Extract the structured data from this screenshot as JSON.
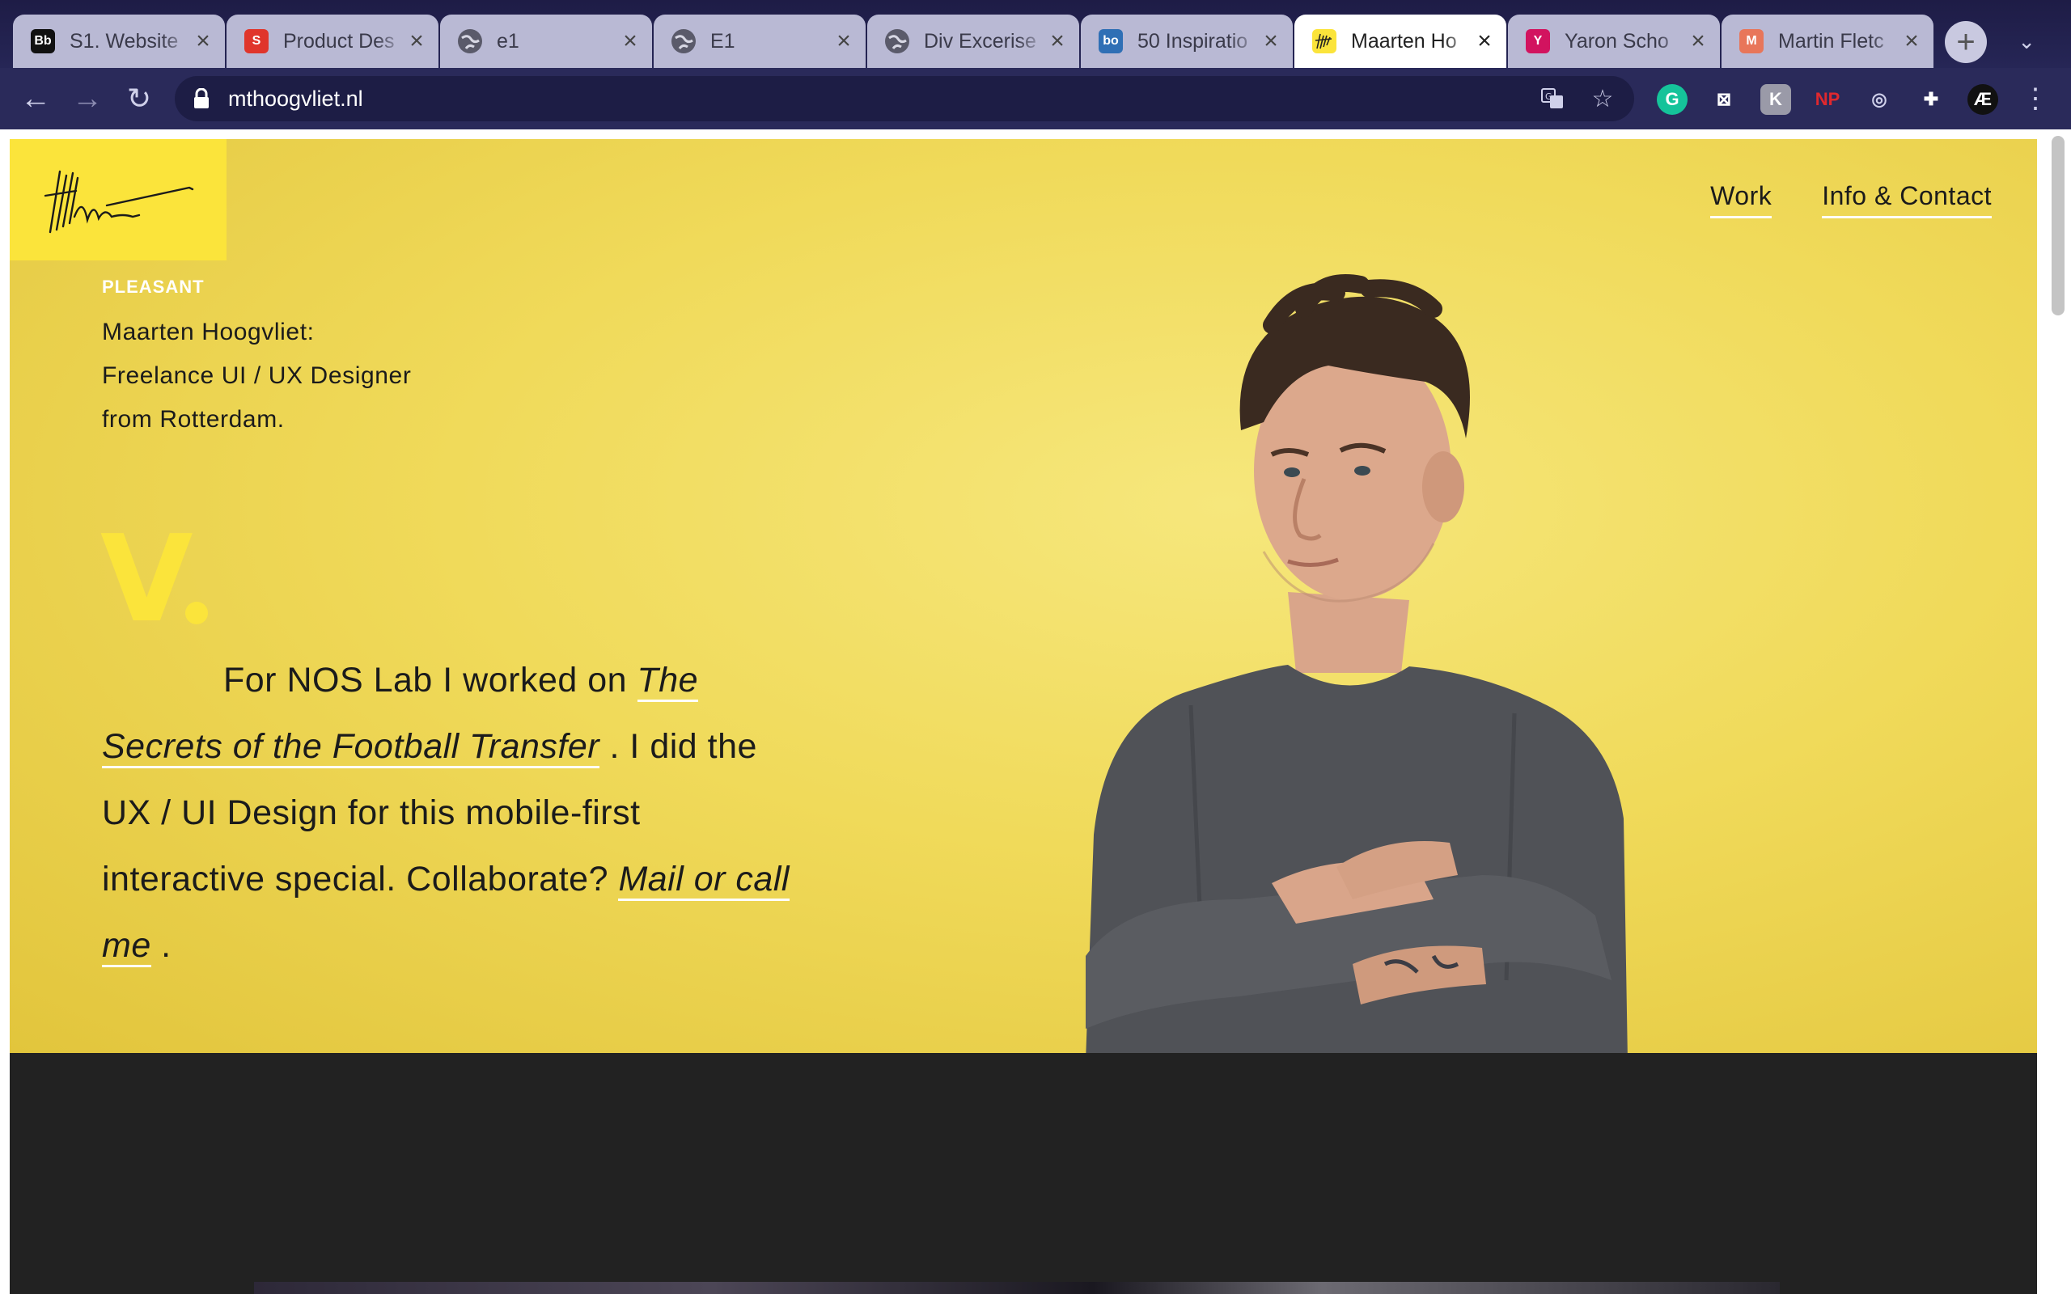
{
  "browser": {
    "tabs": [
      {
        "title": "S1. Website",
        "icon": "blackboard-icon",
        "favicon_text": "Bb",
        "favicon_bg": "#111111"
      },
      {
        "title": "Product Des",
        "icon": "s-logo-icon",
        "favicon_text": "S",
        "favicon_bg": "#e0352b"
      },
      {
        "title": "e1",
        "icon": "globe-icon",
        "favicon_text": "",
        "favicon_bg": "#5a5a6a"
      },
      {
        "title": "E1",
        "icon": "globe-icon",
        "favicon_text": "",
        "favicon_bg": "#5a5a6a"
      },
      {
        "title": "Div Excerise",
        "icon": "globe-icon",
        "favicon_text": "",
        "favicon_bg": "#5a5a6a"
      },
      {
        "title": "50 Inspiratio",
        "icon": "bo-icon",
        "favicon_text": "bo",
        "favicon_bg": "#2f6fb5"
      },
      {
        "title": "Maarten Ho",
        "icon": "signature-icon",
        "favicon_text": "",
        "favicon_bg": "#fbe43b"
      },
      {
        "title": "Yaron Scho",
        "icon": "y-logo-icon",
        "favicon_text": "Y",
        "favicon_bg": "#d2135f"
      },
      {
        "title": "Martin Fletc",
        "icon": "m-logo-icon",
        "favicon_text": "M",
        "favicon_bg": "#e8765a"
      }
    ],
    "active_tab_index": 6,
    "url": "mthoogvliet.nl",
    "extensions": [
      {
        "name": "grammarly-icon",
        "text": "G",
        "bg": "#15c39a",
        "color": "#ffffff"
      },
      {
        "name": "bookmark-ext-icon",
        "text": "⊠",
        "bg": "#2a2a5a",
        "color": "#ffffff"
      },
      {
        "name": "k-ext-icon",
        "text": "K",
        "bg": "#9a9aa8",
        "color": "#ffffff"
      },
      {
        "name": "np-ext-icon",
        "text": "NP",
        "bg": "#2a2a5a",
        "color": "#e0282e"
      },
      {
        "name": "shield-ext-icon",
        "text": "◎",
        "bg": "#2a2a5a",
        "color": "#cfd0ea"
      },
      {
        "name": "puzzle-icon",
        "text": "✚",
        "bg": "#2a2a5a",
        "color": "#ffffff"
      },
      {
        "name": "profile-icon",
        "text": "Æ",
        "bg": "#111111",
        "color": "#ffffff"
      }
    ]
  },
  "site": {
    "nav": {
      "work": "Work",
      "contact": "Info & Contact"
    },
    "eyebrow": "PLEASANT",
    "intro": [
      "Maarten Hoogvliet:",
      "Freelance UI / UX Designer",
      "from Rotterdam."
    ],
    "drop_cap": "V",
    "story": {
      "prefix": "For NOS Lab I worked on ",
      "project_link": "The Secrets of the Football Transfer",
      "middle": " . I did the UX / UI Design for this mobile-first interactive special. Collaborate? ",
      "contact_link": "Mail or call me",
      "suffix": " ."
    },
    "accent_color": "#fbe43b"
  }
}
